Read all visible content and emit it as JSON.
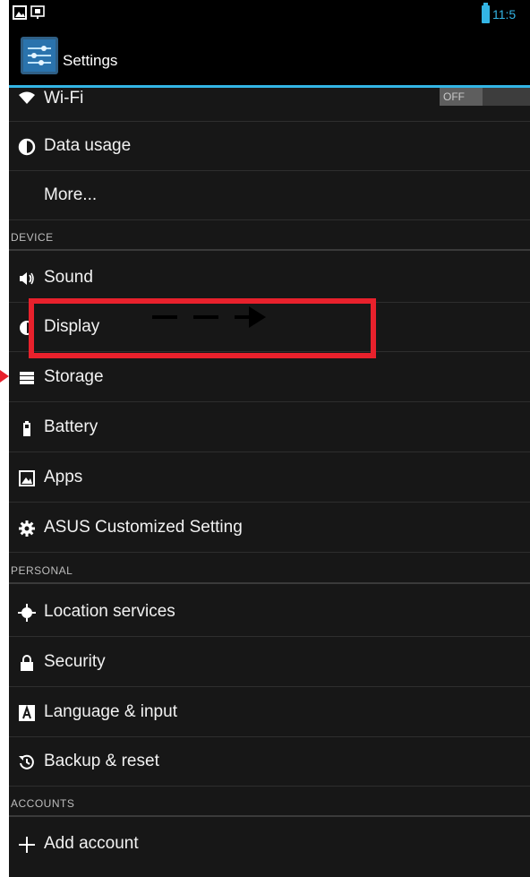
{
  "status_bar": {
    "time": "11:5"
  },
  "action_bar": {
    "title": "Settings"
  },
  "wifi": {
    "label": "Wi-Fi",
    "toggle": "OFF"
  },
  "rows_top": [
    {
      "label": "Data usage",
      "icon": "data-usage-icon"
    },
    {
      "label": "More...",
      "icon": ""
    }
  ],
  "headers": {
    "device": "DEVICE",
    "personal": "PERSONAL",
    "accounts": "ACCOUNTS"
  },
  "device_items": [
    {
      "label": "Sound",
      "icon": "sound-icon"
    },
    {
      "label": "Display",
      "icon": "display-icon"
    },
    {
      "label": "Storage",
      "icon": "storage-icon"
    },
    {
      "label": "Battery",
      "icon": "battery-icon"
    },
    {
      "label": "Apps",
      "icon": "apps-icon"
    },
    {
      "label": "ASUS Customized Setting",
      "icon": "gear-icon"
    }
  ],
  "personal_items": [
    {
      "label": "Location services",
      "icon": "location-icon"
    },
    {
      "label": "Security",
      "icon": "lock-icon"
    },
    {
      "label": "Language & input",
      "icon": "keyboard-icon"
    },
    {
      "label": "Backup & reset",
      "icon": "backup-icon"
    }
  ],
  "account_items": [
    {
      "label": "Add account",
      "icon": "plus-icon"
    }
  ],
  "annotation": {
    "highlight_color": "#e8212c",
    "accent": "#33b5e5"
  }
}
